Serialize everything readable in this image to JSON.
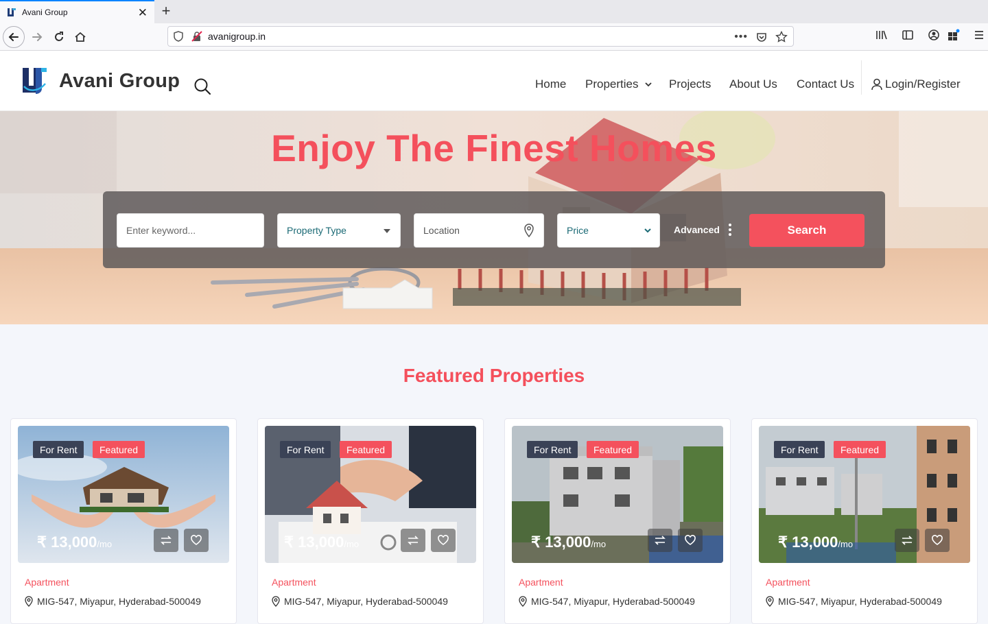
{
  "browser": {
    "tab_title": "Avani Group",
    "url": "avanigroup.in"
  },
  "header": {
    "brand": "Avani Group",
    "nav": [
      "Home",
      "Properties",
      "Projects",
      "About Us",
      "Contact Us"
    ],
    "login": "Login/Register"
  },
  "hero": {
    "title": "Enjoy The Finest Homes",
    "keyword_placeholder": "Enter keyword...",
    "property_type": "Property Type",
    "location": "Location",
    "price": "Price",
    "advanced": "Advanced",
    "search": "Search"
  },
  "featured": {
    "title": "Featured Properties",
    "cards": [
      {
        "rent": "For Rent",
        "feat": "Featured",
        "price": "₹ 13,000",
        "per": "/mo",
        "type": "Apartment",
        "address": "MIG-547, Miyapur, Hyderabad-500049"
      },
      {
        "rent": "For Rent",
        "feat": "Featured",
        "price": "₹ 13,000",
        "per": "/mo",
        "type": "Apartment",
        "address": "MIG-547, Miyapur, Hyderabad-500049"
      },
      {
        "rent": "For Rent",
        "feat": "Featured",
        "price": "₹ 13,000",
        "per": "/mo",
        "type": "Apartment",
        "address": "MIG-547, Miyapur, Hyderabad-500049"
      },
      {
        "rent": "For Rent",
        "feat": "Featured",
        "price": "₹ 13,000",
        "per": "/mo",
        "type": "Apartment",
        "address": "MIG-547, Miyapur, Hyderabad-500049"
      }
    ]
  },
  "colors": {
    "accent": "#f4515d",
    "dark_badge": "#3a4256",
    "search_panel": "#5f5a5a"
  }
}
